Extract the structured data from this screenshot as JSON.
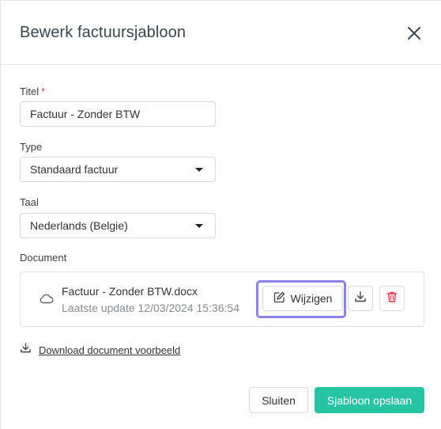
{
  "modal": {
    "title": "Bewerk factuursjabloon"
  },
  "form": {
    "title_label": "Titel",
    "required_marker": "*",
    "title_value": "Factuur - Zonder BTW",
    "type_label": "Type",
    "type_value": "Standaard factuur",
    "language_label": "Taal",
    "language_value": "Nederlands (Belgie)",
    "document_label": "Document"
  },
  "document": {
    "file_name": "Factuur - Zonder BTW.docx",
    "last_update": "Laatste update 12/03/2024 15:36:54",
    "change_label": "Wijzigen",
    "icons": [
      "cloud-icon",
      "edit-icon",
      "download-icon",
      "trash-icon"
    ]
  },
  "download_preview_label": "Download document voorbeeld",
  "footer": {
    "close_label": "Sluiten",
    "save_label": "Sjabloon opslaan"
  },
  "colors": {
    "accent": "#27c4a4",
    "focus": "#8b83e6",
    "danger": "#e0364f"
  }
}
